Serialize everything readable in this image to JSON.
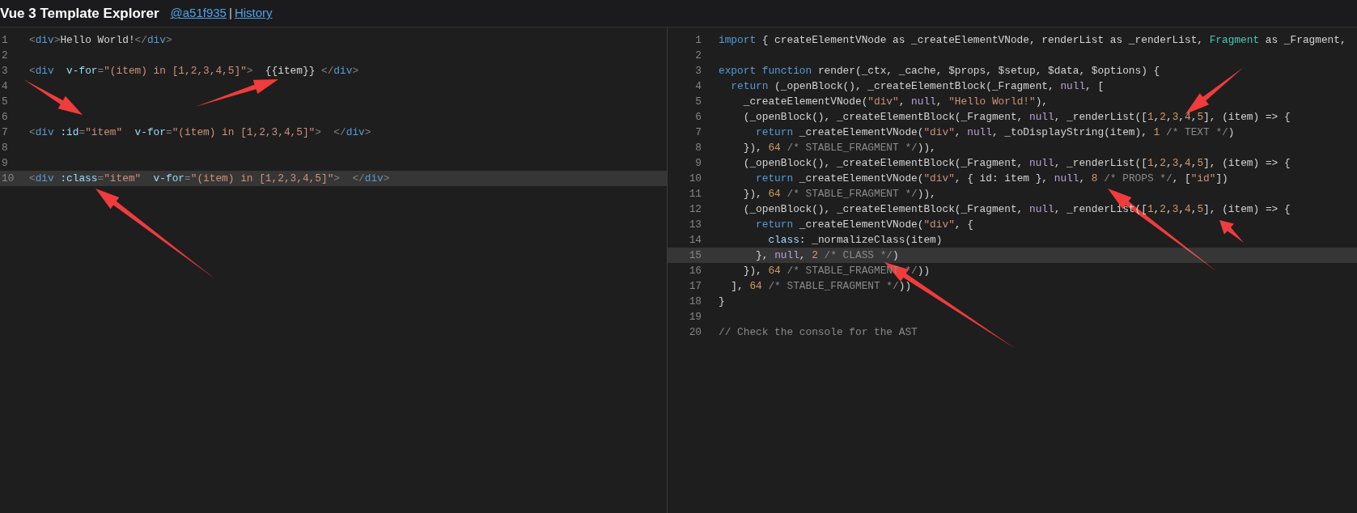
{
  "header": {
    "title": "Vue 3 Template Explorer",
    "commit_link": "@a51f935",
    "separator": "|",
    "history_link": "History"
  },
  "panes": [
    {
      "lines": [
        {
          "number": "1",
          "current": false,
          "tokens": [
            {
              "kind": "punct",
              "text": "<"
            },
            {
              "kind": "tag",
              "text": "div"
            },
            {
              "kind": "punct",
              "text": ">"
            },
            {
              "kind": "plain",
              "text": "Hello World!"
            },
            {
              "kind": "punct",
              "text": "</"
            },
            {
              "kind": "tag",
              "text": "div"
            },
            {
              "kind": "punct",
              "text": ">"
            }
          ]
        },
        {
          "number": "2",
          "current": false
        },
        {
          "number": "3",
          "current": false,
          "tokens": [
            {
              "kind": "punct",
              "text": "<"
            },
            {
              "kind": "tag",
              "text": "div  "
            },
            {
              "kind": "attr",
              "text": "v-for"
            },
            {
              "kind": "punct",
              "text": "="
            },
            {
              "kind": "str",
              "text": "\"(item) in [1,2,3,4,5]\""
            },
            {
              "kind": "punct",
              "text": ">"
            },
            {
              "kind": "plain",
              "text": "  {{item}} "
            },
            {
              "kind": "punct",
              "text": "</"
            },
            {
              "kind": "tag",
              "text": "div"
            },
            {
              "kind": "punct",
              "text": ">"
            }
          ]
        },
        {
          "number": "4",
          "current": false
        },
        {
          "number": "5",
          "current": false
        },
        {
          "number": "6",
          "current": false
        },
        {
          "number": "7",
          "current": false,
          "tokens": [
            {
              "kind": "punct",
              "text": "<"
            },
            {
              "kind": "tag",
              "text": "div "
            },
            {
              "kind": "attr",
              "text": ":id"
            },
            {
              "kind": "punct",
              "text": "="
            },
            {
              "kind": "str",
              "text": "\"item\"  "
            },
            {
              "kind": "attr",
              "text": "v-for"
            },
            {
              "kind": "punct",
              "text": "="
            },
            {
              "kind": "str",
              "text": "\"(item) in [1,2,3,4,5]\""
            },
            {
              "kind": "punct",
              "text": ">  </"
            },
            {
              "kind": "tag",
              "text": "div"
            },
            {
              "kind": "punct",
              "text": ">"
            }
          ]
        },
        {
          "number": "8",
          "current": false
        },
        {
          "number": "9",
          "current": false
        },
        {
          "number": "10",
          "current": true,
          "tokens": [
            {
              "kind": "punct",
              "text": "<"
            },
            {
              "kind": "tag",
              "text": "div "
            },
            {
              "kind": "attr",
              "text": ":class"
            },
            {
              "kind": "punct",
              "text": "="
            },
            {
              "kind": "str",
              "text": "\"item\"  "
            },
            {
              "kind": "attr",
              "text": "v-for"
            },
            {
              "kind": "punct",
              "text": "="
            },
            {
              "kind": "str",
              "text": "\"(item) in [1,2,3,4,5]\""
            },
            {
              "kind": "punct",
              "text": ">  </"
            },
            {
              "kind": "tag",
              "text": "div"
            },
            {
              "kind": "punct",
              "text": ">"
            }
          ]
        }
      ]
    },
    {
      "lines": [
        {
          "number": "1",
          "current": false,
          "tokens": [
            {
              "kind": "keyword",
              "text": "import"
            },
            {
              "kind": "plain",
              "text": " { createElementVNode as _createElementVNode, renderList as _renderList, "
            },
            {
              "kind": "type",
              "text": "Fragment"
            },
            {
              "kind": "plain",
              "text": " as _Fragment,"
            }
          ]
        },
        {
          "number": "2",
          "current": false
        },
        {
          "number": "3",
          "current": false,
          "tokens": [
            {
              "kind": "keyword",
              "text": "export function"
            },
            {
              "kind": "plain",
              "text": " render(_ctx, _cache, $props, $setup, $data, $options) {"
            }
          ]
        },
        {
          "number": "4",
          "current": false,
          "tokens": [
            {
              "kind": "keyword",
              "text": "  return"
            },
            {
              "kind": "plain",
              "text": " (_openBlock(), _createElementBlock(_Fragment, "
            },
            {
              "kind": "null",
              "text": "null"
            },
            {
              "kind": "plain",
              "text": ", ["
            }
          ]
        },
        {
          "number": "5",
          "current": false,
          "tokens": [
            {
              "kind": "plain",
              "text": "    _createElementVNode("
            },
            {
              "kind": "str",
              "text": "\"div\""
            },
            {
              "kind": "plain",
              "text": ", "
            },
            {
              "kind": "null",
              "text": "null"
            },
            {
              "kind": "plain",
              "text": ", "
            },
            {
              "kind": "str",
              "text": "\"Hello World!\""
            },
            {
              "kind": "plain",
              "text": "),"
            }
          ]
        },
        {
          "number": "6",
          "current": false,
          "tokens": [
            {
              "kind": "plain",
              "text": "    (_openBlock(), _createElementBlock(_Fragment, "
            },
            {
              "kind": "null",
              "text": "null"
            },
            {
              "kind": "plain",
              "text": ", _renderList(["
            },
            {
              "kind": "num",
              "text": "1"
            },
            {
              "kind": "plain",
              "text": ","
            },
            {
              "kind": "num",
              "text": "2"
            },
            {
              "kind": "plain",
              "text": ","
            },
            {
              "kind": "num",
              "text": "3"
            },
            {
              "kind": "plain",
              "text": ","
            },
            {
              "kind": "num",
              "text": "4"
            },
            {
              "kind": "plain",
              "text": ","
            },
            {
              "kind": "num",
              "text": "5"
            },
            {
              "kind": "plain",
              "text": "], (item) => {"
            }
          ]
        },
        {
          "number": "7",
          "current": false,
          "tokens": [
            {
              "kind": "keyword",
              "text": "      return"
            },
            {
              "kind": "plain",
              "text": " _createElementVNode("
            },
            {
              "kind": "str",
              "text": "\"div\""
            },
            {
              "kind": "plain",
              "text": ", "
            },
            {
              "kind": "null",
              "text": "null"
            },
            {
              "kind": "plain",
              "text": ", _toDisplayString(item), "
            },
            {
              "kind": "num",
              "text": "1"
            },
            {
              "kind": "comment",
              "text": " /* TEXT */"
            },
            {
              "kind": "plain",
              "text": ")"
            }
          ]
        },
        {
          "number": "8",
          "current": false,
          "tokens": [
            {
              "kind": "plain",
              "text": "    }), "
            },
            {
              "kind": "num",
              "text": "64"
            },
            {
              "kind": "comment",
              "text": " /* STABLE_FRAGMENT */"
            },
            {
              "kind": "plain",
              "text": ")),"
            }
          ]
        },
        {
          "number": "9",
          "current": false,
          "tokens": [
            {
              "kind": "plain",
              "text": "    (_openBlock(), _createElementBlock(_Fragment, "
            },
            {
              "kind": "null",
              "text": "null"
            },
            {
              "kind": "plain",
              "text": ", _renderList(["
            },
            {
              "kind": "num",
              "text": "1"
            },
            {
              "kind": "plain",
              "text": ","
            },
            {
              "kind": "num",
              "text": "2"
            },
            {
              "kind": "plain",
              "text": ","
            },
            {
              "kind": "num",
              "text": "3"
            },
            {
              "kind": "plain",
              "text": ","
            },
            {
              "kind": "num",
              "text": "4"
            },
            {
              "kind": "plain",
              "text": ","
            },
            {
              "kind": "num",
              "text": "5"
            },
            {
              "kind": "plain",
              "text": "], (item) => {"
            }
          ]
        },
        {
          "number": "10",
          "current": false,
          "tokens": [
            {
              "kind": "keyword",
              "text": "      return"
            },
            {
              "kind": "plain",
              "text": " _createElementVNode("
            },
            {
              "kind": "str",
              "text": "\"div\""
            },
            {
              "kind": "plain",
              "text": ", { id: item }, "
            },
            {
              "kind": "null",
              "text": "null"
            },
            {
              "kind": "plain",
              "text": ", "
            },
            {
              "kind": "num",
              "text": "8"
            },
            {
              "kind": "comment",
              "text": " /* PROPS */"
            },
            {
              "kind": "plain",
              "text": ", ["
            },
            {
              "kind": "str",
              "text": "\"id\""
            },
            {
              "kind": "plain",
              "text": "])"
            }
          ]
        },
        {
          "number": "11",
          "current": false,
          "tokens": [
            {
              "kind": "plain",
              "text": "    }), "
            },
            {
              "kind": "num",
              "text": "64"
            },
            {
              "kind": "comment",
              "text": " /* STABLE_FRAGMENT */"
            },
            {
              "kind": "plain",
              "text": ")),"
            }
          ]
        },
        {
          "number": "12",
          "current": false,
          "tokens": [
            {
              "kind": "plain",
              "text": "    (_openBlock(), _createElementBlock(_Fragment, "
            },
            {
              "kind": "null",
              "text": "null"
            },
            {
              "kind": "plain",
              "text": ", _renderList(["
            },
            {
              "kind": "num",
              "text": "1"
            },
            {
              "kind": "plain",
              "text": ","
            },
            {
              "kind": "num",
              "text": "2"
            },
            {
              "kind": "plain",
              "text": ","
            },
            {
              "kind": "num",
              "text": "3"
            },
            {
              "kind": "plain",
              "text": ","
            },
            {
              "kind": "num",
              "text": "4"
            },
            {
              "kind": "plain",
              "text": ","
            },
            {
              "kind": "num",
              "text": "5"
            },
            {
              "kind": "plain",
              "text": "], (item) => {"
            }
          ]
        },
        {
          "number": "13",
          "current": false,
          "tokens": [
            {
              "kind": "keyword",
              "text": "      return"
            },
            {
              "kind": "plain",
              "text": " _createElementVNode("
            },
            {
              "kind": "str",
              "text": "\"div\""
            },
            {
              "kind": "plain",
              "text": ", {"
            }
          ]
        },
        {
          "number": "14",
          "current": false,
          "tokens": [
            {
              "kind": "attr",
              "text": "        class"
            },
            {
              "kind": "plain",
              "text": ": _normalizeClass(item)"
            }
          ]
        },
        {
          "number": "15",
          "current": true,
          "tokens": [
            {
              "kind": "plain",
              "text": "      }, "
            },
            {
              "kind": "null",
              "text": "null"
            },
            {
              "kind": "plain",
              "text": ", "
            },
            {
              "kind": "num",
              "text": "2"
            },
            {
              "kind": "comment",
              "text": " /* CLASS */"
            },
            {
              "kind": "plain",
              "text": ")"
            }
          ]
        },
        {
          "number": "16",
          "current": false,
          "tokens": [
            {
              "kind": "plain",
              "text": "    }), "
            },
            {
              "kind": "num",
              "text": "64"
            },
            {
              "kind": "comment",
              "text": " /* STABLE_FRAGMENT */"
            },
            {
              "kind": "plain",
              "text": "))"
            }
          ]
        },
        {
          "number": "17",
          "current": false,
          "tokens": [
            {
              "kind": "plain",
              "text": "  ], "
            },
            {
              "kind": "num",
              "text": "64"
            },
            {
              "kind": "comment",
              "text": " /* STABLE_FRAGMENT */"
            },
            {
              "kind": "plain",
              "text": "))"
            }
          ]
        },
        {
          "number": "18",
          "current": false,
          "tokens": [
            {
              "kind": "plain",
              "text": "}"
            }
          ]
        },
        {
          "number": "19",
          "current": false
        },
        {
          "number": "20",
          "current": false,
          "tokens": [
            {
              "kind": "comment",
              "text": "// Check the console for the AST"
            }
          ]
        }
      ]
    }
  ]
}
